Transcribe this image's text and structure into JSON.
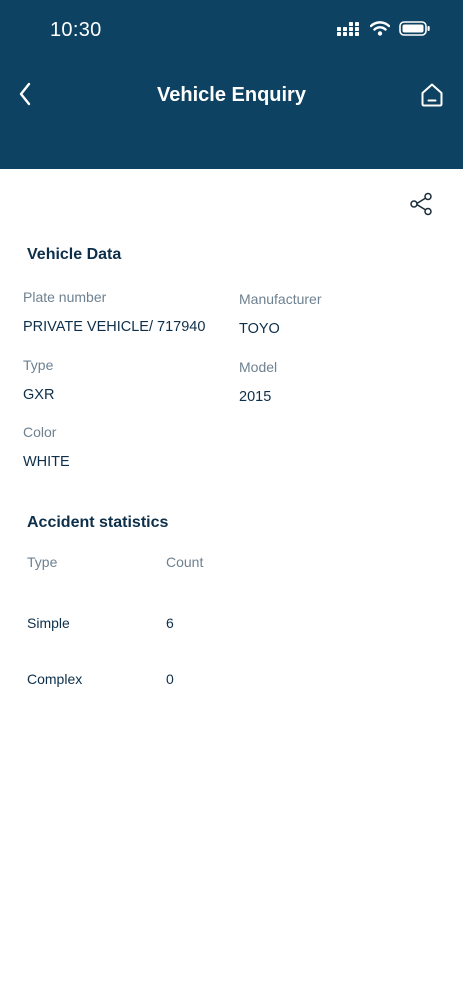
{
  "status_bar": {
    "time": "10:30"
  },
  "nav": {
    "title": "Vehicle Enquiry",
    "back_icon": "chevron-left-icon",
    "home_icon": "home-icon",
    "share_icon": "share-icon"
  },
  "vehicle_data": {
    "title": "Vehicle Data",
    "fields": [
      {
        "label": "Plate number",
        "value": "PRIVATE VEHICLE/ 717940"
      },
      {
        "label": "Manufacturer",
        "value": "TOYO"
      },
      {
        "label": "Type",
        "value": "GXR"
      },
      {
        "label": "Model",
        "value": "2015"
      },
      {
        "label": "Color",
        "value": "WHITE"
      }
    ]
  },
  "accident_statistics": {
    "title": "Accident statistics",
    "columns": [
      "Type",
      "Count"
    ],
    "rows": [
      {
        "type": "Simple",
        "count": "6"
      },
      {
        "type": "Complex",
        "count": "0"
      }
    ]
  },
  "colors": {
    "header_bg": "#0d4262",
    "text_dark": "#0d2f4a",
    "text_muted": "#6e8190"
  }
}
